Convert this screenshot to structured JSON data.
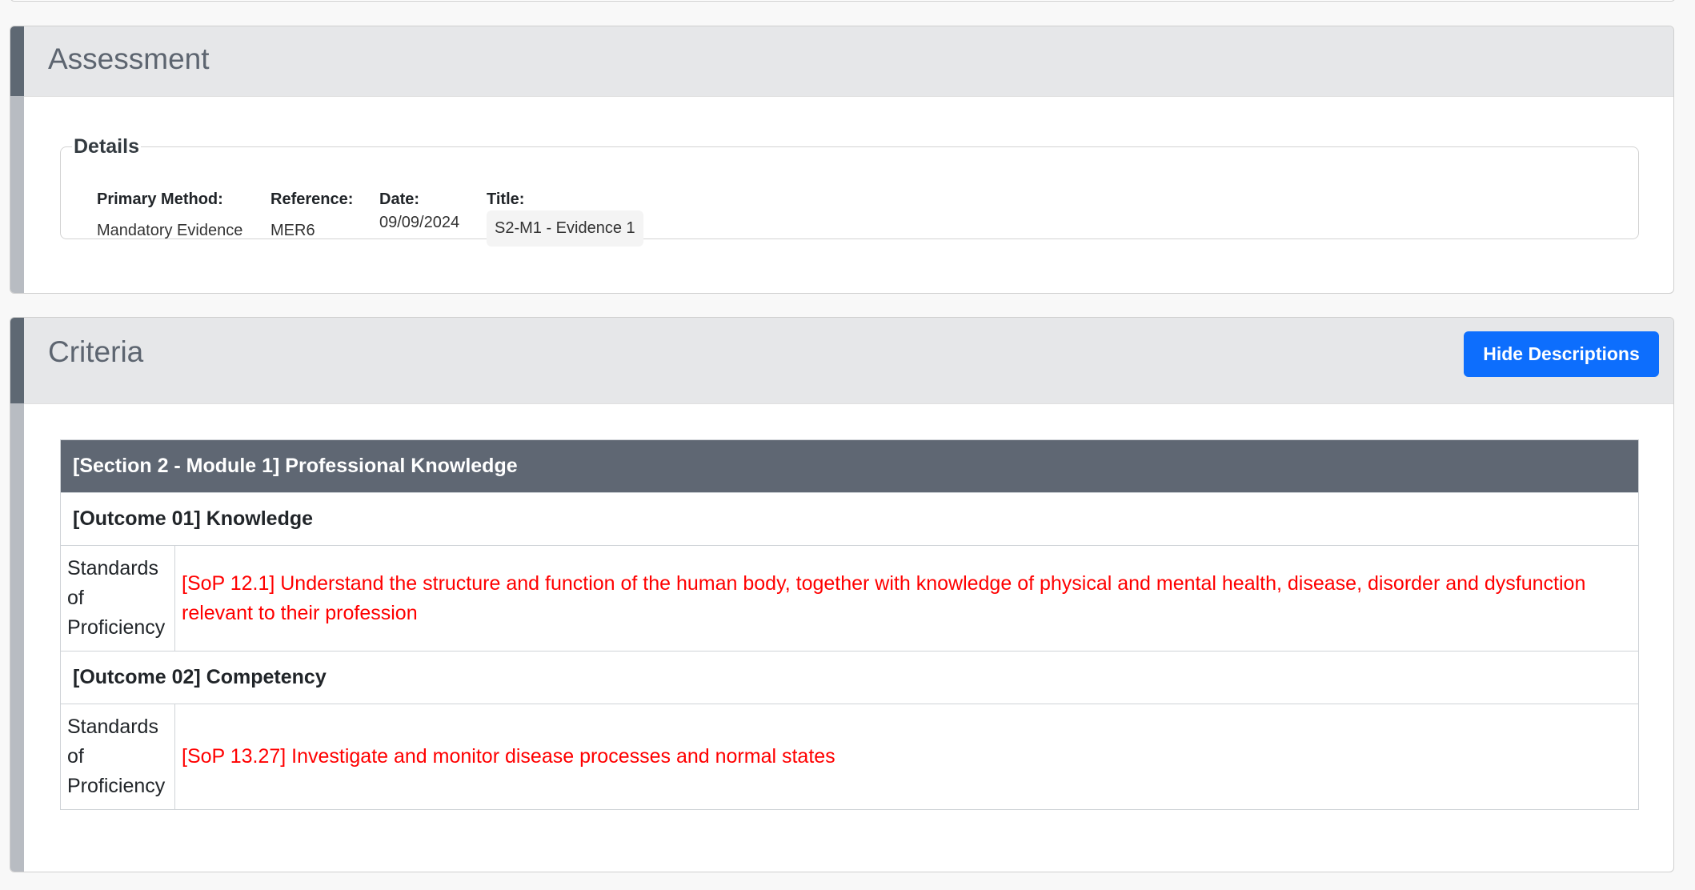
{
  "assessment": {
    "title": "Assessment",
    "details": {
      "legend": "Details",
      "primary_method_label": "Primary Method:",
      "primary_method_value": "Mandatory Evidence",
      "reference_label": "Reference:",
      "reference_value": "MER6",
      "date_label": "Date:",
      "date_value": "09/09/2024",
      "title_label": "Title:",
      "title_value": "S2-M1 - Evidence 1"
    }
  },
  "criteria": {
    "title": "Criteria",
    "hide_descriptions_label": "Hide Descriptions",
    "section": "[Section 2 - Module 1] Professional Knowledge",
    "outcomes": [
      {
        "heading": "[Outcome 01] Knowledge",
        "standard_label": "Standards of Proficiency",
        "standard_text": "[SoP 12.1] Understand the structure and function of the human body, together with knowledge of physical and mental health, disease, disorder and dysfunction relevant to their profession"
      },
      {
        "heading": "[Outcome 02] Competency",
        "standard_label": "Standards of Proficiency",
        "standard_text": "[SoP 13.27] Investigate and monitor disease processes and normal states"
      }
    ]
  },
  "colors": {
    "accent_blue": "#0d6efd",
    "section_header": "#5f6773",
    "sop_text": "#ff0000"
  }
}
